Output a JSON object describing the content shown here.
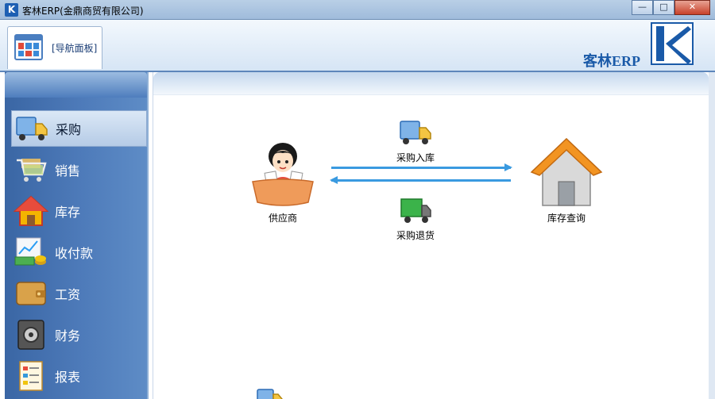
{
  "window": {
    "title": "客林ERP(金鼎商贸有限公司)",
    "controls": [
      "minimize",
      "maximize",
      "close"
    ]
  },
  "header": {
    "nav_tab_label": "[导航面板]",
    "brand_text": "客林ERP",
    "brand_color": "#1a5aa8"
  },
  "sidebar": {
    "items": [
      {
        "label": "采购",
        "icon": "truck-icon",
        "active": true
      },
      {
        "label": "销售",
        "icon": "cart-icon",
        "active": false
      },
      {
        "label": "库存",
        "icon": "house-icon",
        "active": false
      },
      {
        "label": "收付款",
        "icon": "money-chart-icon",
        "active": false
      },
      {
        "label": "工资",
        "icon": "wallet-icon",
        "active": false
      },
      {
        "label": "财务",
        "icon": "safe-icon",
        "active": false
      },
      {
        "label": "报表",
        "icon": "report-icon",
        "active": false
      }
    ]
  },
  "main": {
    "nodes": {
      "supplier": "供应商",
      "purchase_in": "采购入库",
      "purchase_return": "采购退货",
      "stock_query": "库存查询"
    },
    "arrow_color": "#3a9ae0"
  }
}
